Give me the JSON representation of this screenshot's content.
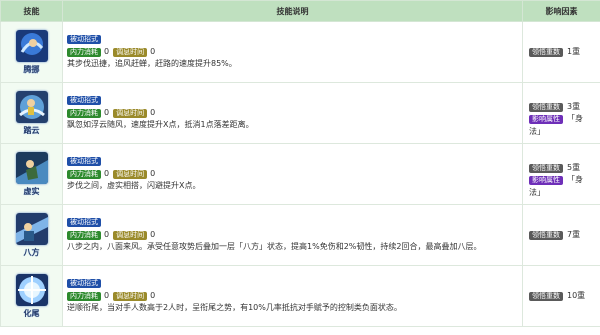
{
  "header": {
    "col_skill": "技能",
    "col_desc": "技能说明",
    "col_factor": "影响因素"
  },
  "tags": {
    "passive": "被动招式",
    "inner": "内力消耗",
    "cooldown": "调息时间"
  },
  "colors": {
    "header_bg": "#bfe0bf",
    "passive": "#1f4fa8",
    "inner": "#2d8a2d",
    "cooldown": "#9a8a2a",
    "factor_gray": "#5a5a5a",
    "factor_purple": "#6e2fb8"
  },
  "rows": [
    {
      "name": "腾挪",
      "icon": "skill-icon-tengnuo",
      "inner": "0",
      "cooldown": "0",
      "text": "其步伐迅捷，追风赶蝉，赶路的速度提升85%。",
      "factors": [
        {
          "label": "领悟重数",
          "value": "1重",
          "style": "gray"
        }
      ]
    },
    {
      "name": "踏云",
      "icon": "skill-icon-tayun",
      "inner": "0",
      "cooldown": "0",
      "text": "飘忽如浮云随风，速度提升X点，抵消1点落差距离。",
      "factors": [
        {
          "label": "领悟重数",
          "value": "3重",
          "style": "gray"
        },
        {
          "label": "影响属性",
          "value": "「身法」",
          "style": "purple"
        }
      ]
    },
    {
      "name": "虚实",
      "icon": "skill-icon-xushi",
      "inner": "0",
      "cooldown": "0",
      "text": "步伐之间，虚实相搭，闪避提升X点。",
      "factors": [
        {
          "label": "领悟重数",
          "value": "5重",
          "style": "gray"
        },
        {
          "label": "影响属性",
          "value": "「身法」",
          "style": "purple"
        }
      ]
    },
    {
      "name": "八方",
      "icon": "skill-icon-bafang",
      "inner": "0",
      "cooldown": "0",
      "text": "八步之内，八面来风。承受任意攻势后叠加一层「八方」状态，提高1%免伤和2%韧性，持续2回合，最高叠加八层。",
      "factors": [
        {
          "label": "领悟重数",
          "value": "7重",
          "style": "gray"
        }
      ]
    },
    {
      "name": "化尾",
      "icon": "skill-icon-huawei",
      "inner": "0",
      "cooldown": "0",
      "text": "逆顺衔尾，当对手人数高于2人时，呈衔尾之势，有10%几率抵抗对手赋予的控制类负面状态。",
      "factors": [
        {
          "label": "领悟重数",
          "value": "10重",
          "style": "gray"
        }
      ]
    }
  ]
}
